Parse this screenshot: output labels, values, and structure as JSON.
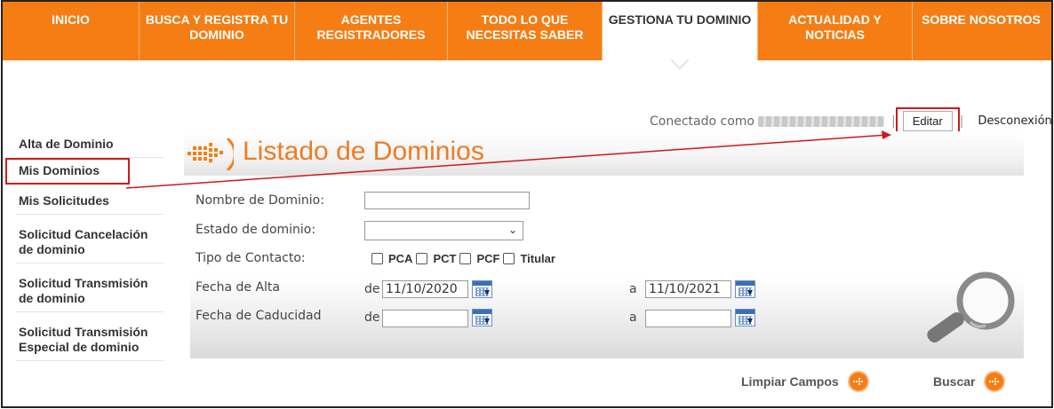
{
  "nav": {
    "items": [
      {
        "label": "INICIO",
        "width": 154
      },
      {
        "label": "BUSCA Y REGISTRA TU DOMINIO",
        "width": 175
      },
      {
        "label": "AGENTES REGISTRADORES",
        "width": 172
      },
      {
        "label": "TODO LO QUE NECESITAS SABER",
        "width": 174
      },
      {
        "label": "GESTIONA TU DOMINIO",
        "width": 175
      },
      {
        "label": "ACTUALIDAD Y NOTICIAS",
        "width": 174
      },
      {
        "label": "SOBRE NOSOTROS",
        "width": 156
      }
    ],
    "active_index": 4
  },
  "session": {
    "connected_label": "Conectado como",
    "sep": "|",
    "edit_label": "Editar",
    "logout_label": "Desconexión"
  },
  "sidebar": {
    "items": [
      {
        "label": "Alta de Dominio"
      },
      {
        "label": "Mis Dominios"
      },
      {
        "label": "Mis Solicitudes"
      },
      {
        "label": "Solicitud Cancelación de dominio"
      },
      {
        "label": "Solicitud Transmisión de dominio"
      },
      {
        "label": "Solicitud Transmisión Especial de dominio"
      }
    ]
  },
  "main": {
    "title": "Listado de Dominios",
    "form": {
      "domain_name_label": "Nombre de Dominio:",
      "domain_name_value": "",
      "status_label": "Estado de dominio:",
      "status_value": "",
      "contact_type_label": "Tipo de Contacto:",
      "contact_types": [
        "PCA",
        "PCT",
        "PCF",
        "Titular"
      ],
      "alta_label": "Fecha de Alta",
      "caducidad_label": "Fecha de Caducidad",
      "from_label": "de",
      "to_label": "a",
      "alta_from": "11/10/2020",
      "alta_to": "11/10/2021",
      "caducidad_from": "",
      "caducidad_to": ""
    },
    "actions": {
      "clear_label": "Limpiar Campos",
      "search_label": "Buscar"
    }
  },
  "colors": {
    "brand_orange": "#f57d14",
    "highlight_red": "#d01818"
  }
}
